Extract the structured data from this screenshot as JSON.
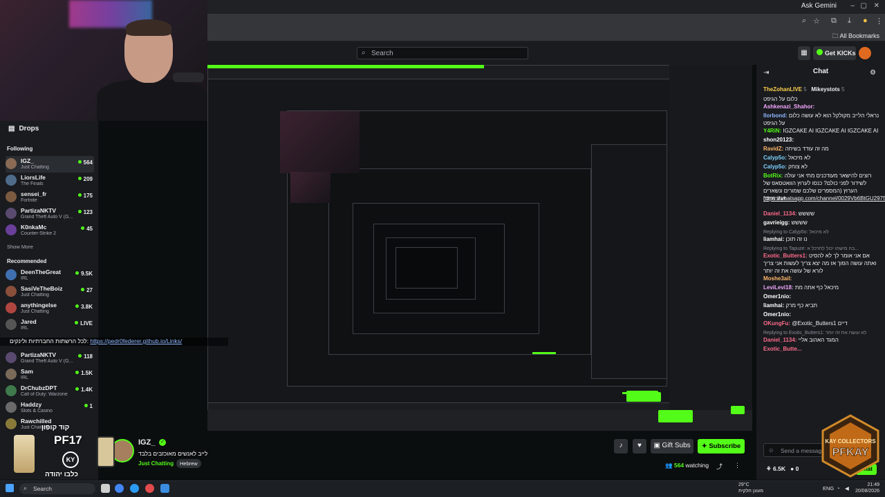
{
  "browser": {
    "ask_gemini": "Ask Gemini",
    "all_bookmarks": "All Bookmarks"
  },
  "header": {
    "search_placeholder": "Search",
    "get_kicks": "Get KICKs"
  },
  "sidebar": {
    "drops": "Drops",
    "following_title": "Following",
    "following": [
      {
        "name": "IGZ_",
        "category": "Just Chatting",
        "viewers": "564",
        "selected": true
      },
      {
        "name": "LiorsLife",
        "category": "The Finals",
        "viewers": "209"
      },
      {
        "name": "sensei_fr",
        "category": "Fortnite",
        "viewers": "175"
      },
      {
        "name": "PartizaNKTV",
        "category": "Grand Theft Auto V (G...",
        "viewers": "123"
      },
      {
        "name": "K0nkaMc",
        "category": "Counter-Strike 2",
        "viewers": "45"
      }
    ],
    "show_more": "Show More",
    "recommended_title": "Recommended",
    "recommended": [
      {
        "name": "DeenTheGreat",
        "category": "IRL",
        "viewers": "9.5K"
      },
      {
        "name": "SasiVeTheBoiz",
        "category": "Just Chatting",
        "viewers": "27"
      },
      {
        "name": "anythingelse",
        "category": "Just Chatting",
        "viewers": "3.8K"
      },
      {
        "name": "Jared",
        "category": "IRL",
        "viewers": "LIVE"
      },
      {
        "name": "PartizaNKTV",
        "category": "Grand Theft Auto V (G...",
        "viewers": "118"
      },
      {
        "name": "Sam",
        "category": "IRL",
        "viewers": "1.5K"
      },
      {
        "name": "DrChubzDPT",
        "category": "Call of Duty: Warzone",
        "viewers": "1.4K"
      },
      {
        "name": "Haddzy",
        "category": "Slots & Casino",
        "viewers": "1"
      },
      {
        "name": "Rawchilled",
        "category": "Just Chatting",
        "viewers": ""
      }
    ]
  },
  "overlay": {
    "link_prefix": "לכל הרשתות החברתיות ולינקים:",
    "link_url": "https://pedr0federer.github.io/Links/"
  },
  "promo": {
    "code_label": "קוד קופון",
    "code": "PF17",
    "brand_mark": "KY",
    "brand": "כלבו יהודה"
  },
  "emblem": {
    "top": "KAY COLLECTORS",
    "main": "PFKAY"
  },
  "streamer": {
    "name": "IGZ_",
    "title": "לייב לאנשים מאוכזבים בלבד",
    "category": "Just Chatting",
    "tag": "Hebrew",
    "gift_subs": "Gift Subs",
    "subscribe": "Subscribe",
    "viewers": "564",
    "watching_label": "watching"
  },
  "chat": {
    "title": "Chat",
    "top_users": [
      {
        "name": "TheZohanLIVE",
        "count": "5"
      },
      {
        "name": "Mikeystots",
        "count": "5"
      }
    ],
    "messages": [
      {
        "user": "",
        "text": "כלום על הגיפט",
        "color": "#efeff1"
      },
      {
        "user": "Ashkenazi_Shahor:",
        "text": "",
        "color": "#f5a8ff"
      },
      {
        "user": "Ilorbond:",
        "text": "נראלי הלייב מקולקל הוא לא עושה כלום על הגיפט",
        "color": "#8fb7ff"
      },
      {
        "user": "Y4RiN:",
        "text": "IGZCAKE AI IGZCAKE AI IGZCAKE AI",
        "color": "#53fc18"
      },
      {
        "user": "shon20123:",
        "text": "",
        "color": "#ffffff"
      },
      {
        "user": "RavidZ:",
        "text": "מה זה עודד בשיחה",
        "color": "#ffb86b"
      },
      {
        "user": "Calyp5o:",
        "text": "לא מיכאל",
        "color": "#7fd3ff"
      },
      {
        "user": "Calyp5o:",
        "text": "לא צוחק",
        "color": "#7fd3ff"
      },
      {
        "user": "BotRix:",
        "text": "רוצים להישאר מעודכנים מתי אני עולה לשידור לפני כולם? כנסו לערוץ הוואטסאפ של הערוץ (המספרים שלכם שמורים ונשארים אנונימיים)",
        "color": "#53fc18"
      },
      {
        "user": "",
        "text": "https://whatsapp.com/channel/0029Vb6BtGU2975J0Dtb4X3b",
        "color": "#efeff1",
        "link": true
      },
      {
        "user": "Daniel_1134:",
        "text": "שששש",
        "color": "#ff6b8b"
      },
      {
        "user": "gavrieigg:",
        "text": "שששש",
        "color": "#ffffff"
      },
      {
        "user": "",
        "text": "Replying to Calyp5o: לא מיכאל",
        "color": "#8d8d98",
        "reply": true
      },
      {
        "user": "liamhai:",
        "text": "נו זה תוכן",
        "color": "#ffffff"
      },
      {
        "user": "",
        "text": "Replying to Tapuze: בה מישהו יכול לתרכל א...",
        "color": "#8d8d98",
        "reply": true
      },
      {
        "user": "Exotic_Butters1:",
        "text": "אם אני אומר לך לא להסיט ואתה עושה הפוך אז מה יצא צריך לעשות אני צריך לורא של עושה את זה יותר",
        "color": "#ff6b8b"
      },
      {
        "user": "Moshe3ail:",
        "text": "",
        "color": "#ffb86b"
      },
      {
        "user": "LeviLevi18:",
        "text": "מיכאל כף אתה מת",
        "color": "#f5a8ff"
      },
      {
        "user": "Omer1nio:",
        "text": "",
        "color": "#ffffff"
      },
      {
        "user": "liamhai:",
        "text": "תביא כף מרק",
        "color": "#ffffff"
      },
      {
        "user": "Omer1nio:",
        "text": "",
        "color": "#ffffff"
      },
      {
        "user": "OKungFu:",
        "text": "@Exotic_Butters1 דיים",
        "color": "#ff6b8b"
      },
      {
        "user": "",
        "text": "Replying to Exotic_Butters1: לא עושה את זה יותר",
        "color": "#8d8d98",
        "reply": true
      },
      {
        "user": "Daniel_1134:",
        "text": "המגד האהוב אליי",
        "color": "#ff6b8b"
      },
      {
        "user": "Exotic_Butte...",
        "text": "",
        "color": "#ff6b8b"
      }
    ],
    "input_placeholder": "Send a message",
    "kicks_count": "6.5K",
    "zero": "0",
    "chat_btn": "Chat"
  },
  "taskbar": {
    "search": "Search",
    "weather_temp": "29°C",
    "weather_desc": "מעונן חלקית",
    "lang": "ENG",
    "time": "21:49",
    "date": "20/08/2026"
  }
}
